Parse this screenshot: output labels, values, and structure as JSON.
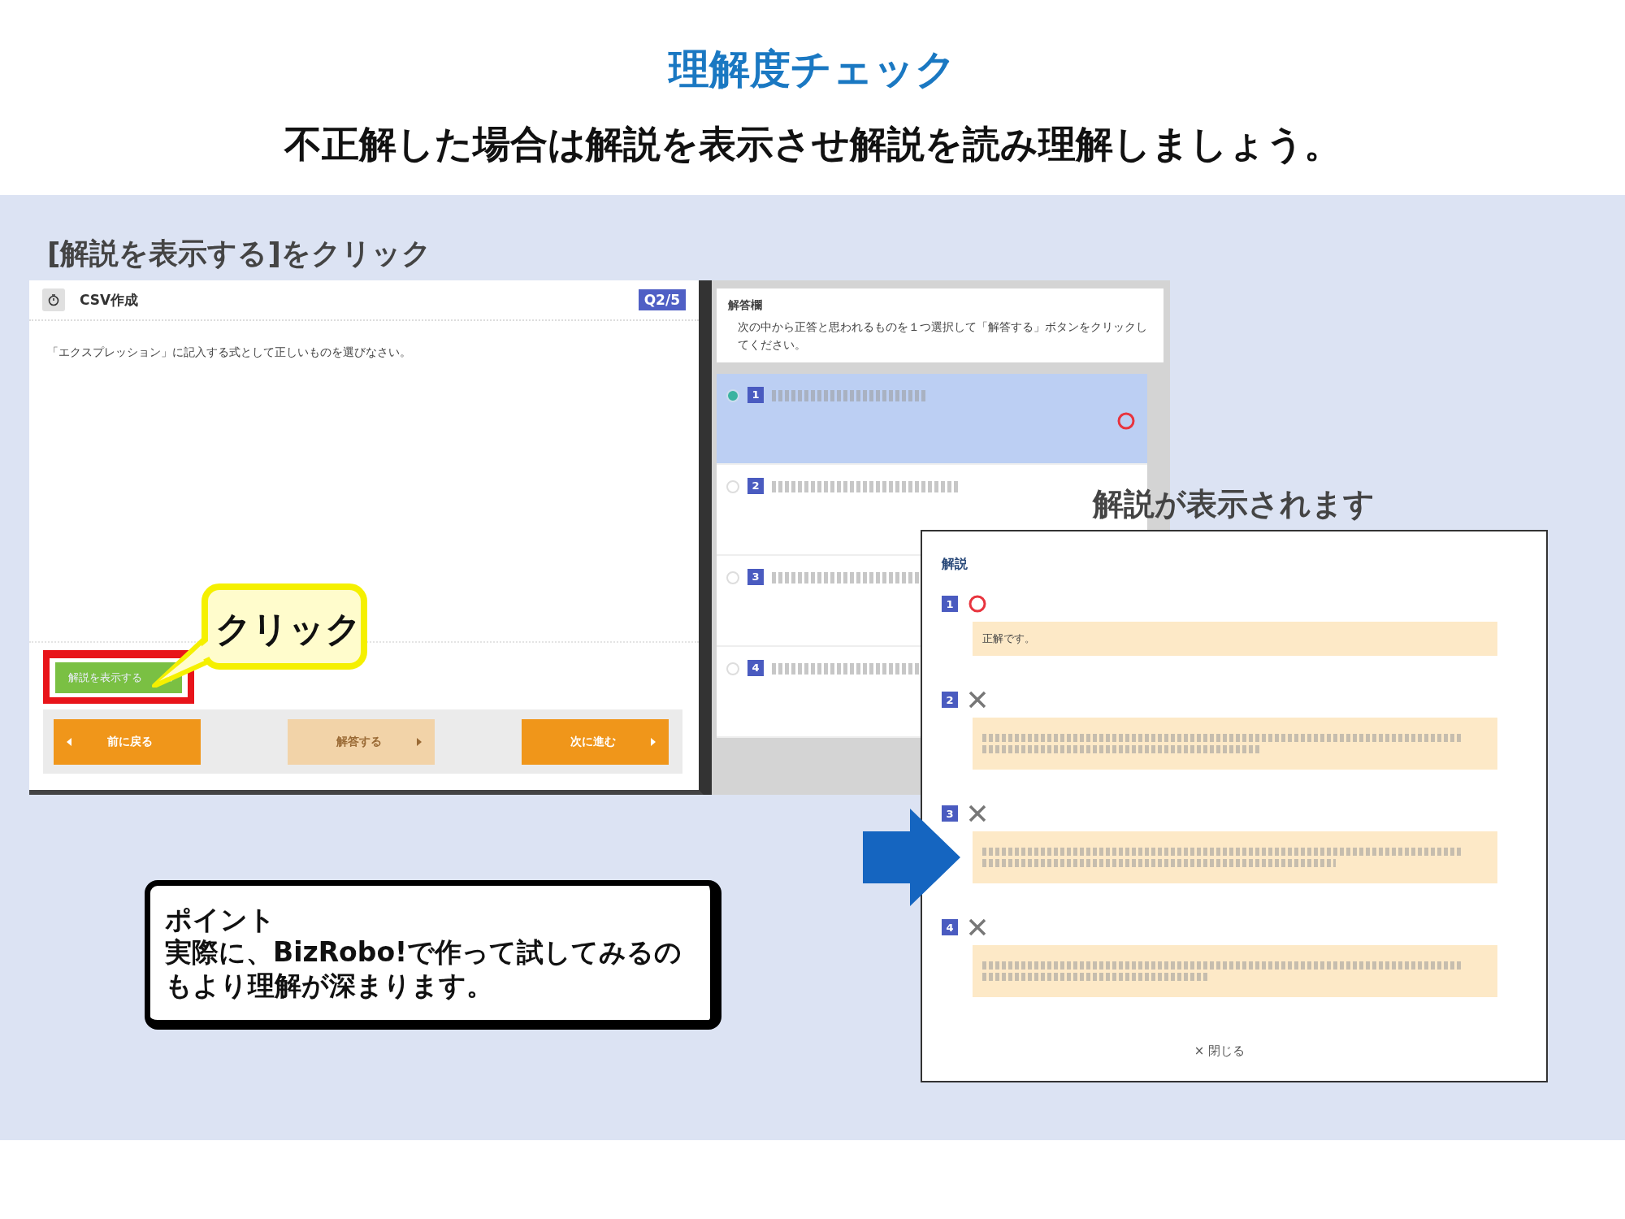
{
  "header": {
    "title": "理解度チェック",
    "subtitle": "不正解した場合は解説を表示させ解説を読み理解しましょう。"
  },
  "instruction_label": "[解説を表示する]をクリック",
  "quiz_screen": {
    "title": "CSV作成",
    "counter": "Q2/5",
    "question": "「エクスプレッション」に記入する式として正しいものを選びなさい。",
    "explain_button": "解説を表示する",
    "nav_buttons": [
      {
        "label": "前に戻る",
        "kind": "back",
        "disabled": false
      },
      {
        "label": "解答する",
        "kind": "forward",
        "disabled": true
      },
      {
        "label": "次に進む",
        "kind": "forward",
        "disabled": false
      }
    ]
  },
  "callout": "クリック",
  "answer_panel": {
    "heading": "解答欄",
    "instructions": "次の中から正答と思われるものを１つ選択して「解答する」ボタンをクリックしてください。",
    "options": [
      {
        "number": "1",
        "selected": true,
        "correct_mark": true
      },
      {
        "number": "2",
        "selected": false,
        "correct_mark": false
      },
      {
        "number": "3",
        "selected": false,
        "correct_mark": false
      },
      {
        "number": "4",
        "selected": false,
        "correct_mark": false
      }
    ]
  },
  "popup_caption": "解説が表示されます",
  "explanation_popup": {
    "heading": "解説",
    "items": [
      {
        "number": "1",
        "correct": true,
        "kind": "text",
        "text": "正解です。"
      },
      {
        "number": "2",
        "correct": false,
        "kind": "blurred"
      },
      {
        "number": "3",
        "correct": false,
        "kind": "blurred"
      },
      {
        "number": "4",
        "correct": false,
        "kind": "blurred"
      }
    ],
    "close_link": "× 閉じる"
  },
  "point_box": {
    "title": "ポイント",
    "body": "実際に、BizRobo!で作って試してみるのもより理解が深まります。"
  }
}
